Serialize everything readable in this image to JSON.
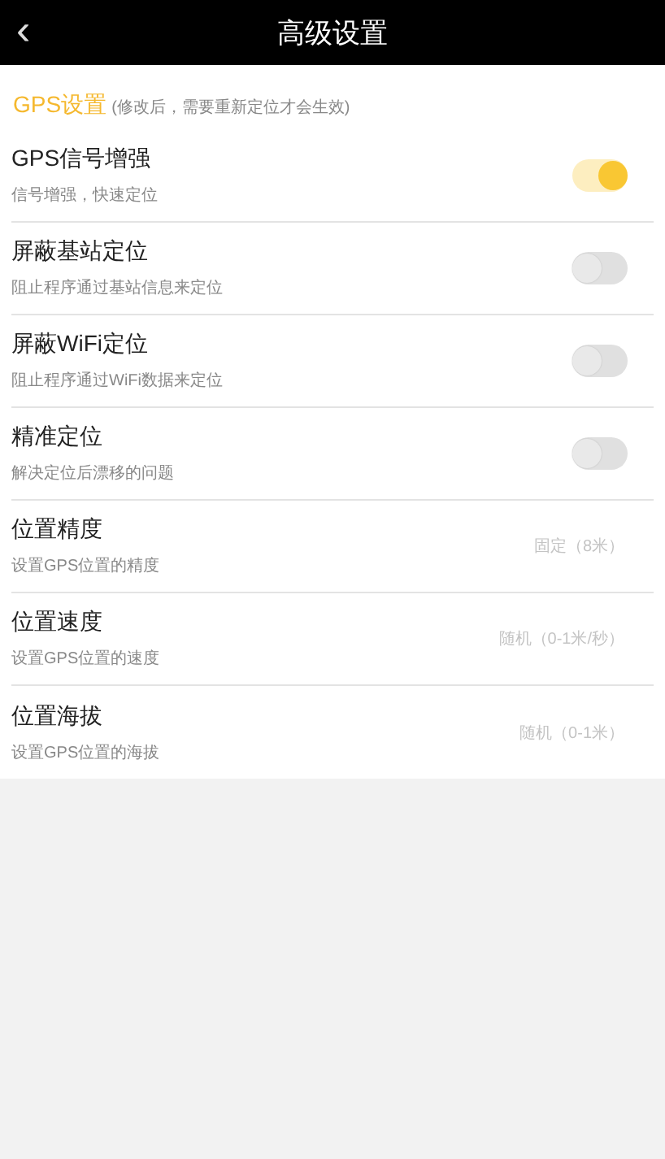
{
  "header": {
    "back": "‹",
    "title": "高级设置"
  },
  "section": {
    "title": "GPS设置",
    "note": "(修改后，需要重新定位才会生效)"
  },
  "rows": [
    {
      "kind": "switch",
      "title": "GPS信号增强",
      "subtitle": "信号增强，快速定位",
      "on": true
    },
    {
      "kind": "switch",
      "title": "屏蔽基站定位",
      "subtitle": "阻止程序通过基站信息来定位",
      "on": false
    },
    {
      "kind": "switch",
      "title": "屏蔽WiFi定位",
      "subtitle": "阻止程序通过WiFi数据来定位",
      "on": false
    },
    {
      "kind": "switch",
      "title": "精准定位",
      "subtitle": "解决定位后漂移的问题",
      "on": false
    },
    {
      "kind": "value",
      "title": "位置精度",
      "subtitle": "设置GPS位置的精度",
      "value": "固定（8米）"
    },
    {
      "kind": "value",
      "title": "位置速度",
      "subtitle": "设置GPS位置的速度",
      "value": "随机（0-1米/秒）"
    },
    {
      "kind": "value",
      "title": "位置海拔",
      "subtitle": "设置GPS位置的海拔",
      "value": "随机（0-1米）"
    }
  ]
}
